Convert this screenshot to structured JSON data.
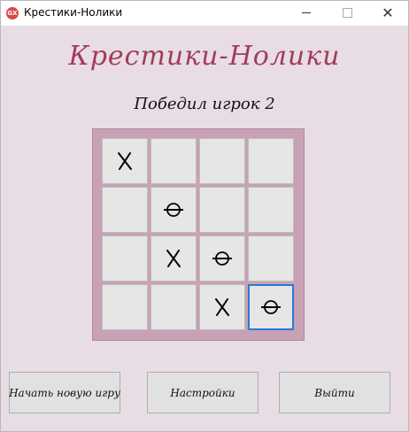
{
  "window": {
    "title": "Крестики-Нолики",
    "icon_label": "GX"
  },
  "app": {
    "heading": "Крестики-Нолики",
    "status": "Победил игрок 2"
  },
  "board": {
    "rows": [
      [
        "X",
        "",
        "",
        ""
      ],
      [
        "",
        "O",
        "",
        ""
      ],
      [
        "",
        "X",
        "O",
        ""
      ],
      [
        "",
        "",
        "X",
        "O"
      ]
    ],
    "selected": [
      3,
      3
    ]
  },
  "buttons": {
    "new_game": "Начать новую игру",
    "settings": "Настройки",
    "exit": "Выйти"
  },
  "colors": {
    "heading": "#a23b5c",
    "board_bg": "#c8a2b4",
    "window_bg": "#e8dde4",
    "selected_border": "#2a7ad5"
  }
}
